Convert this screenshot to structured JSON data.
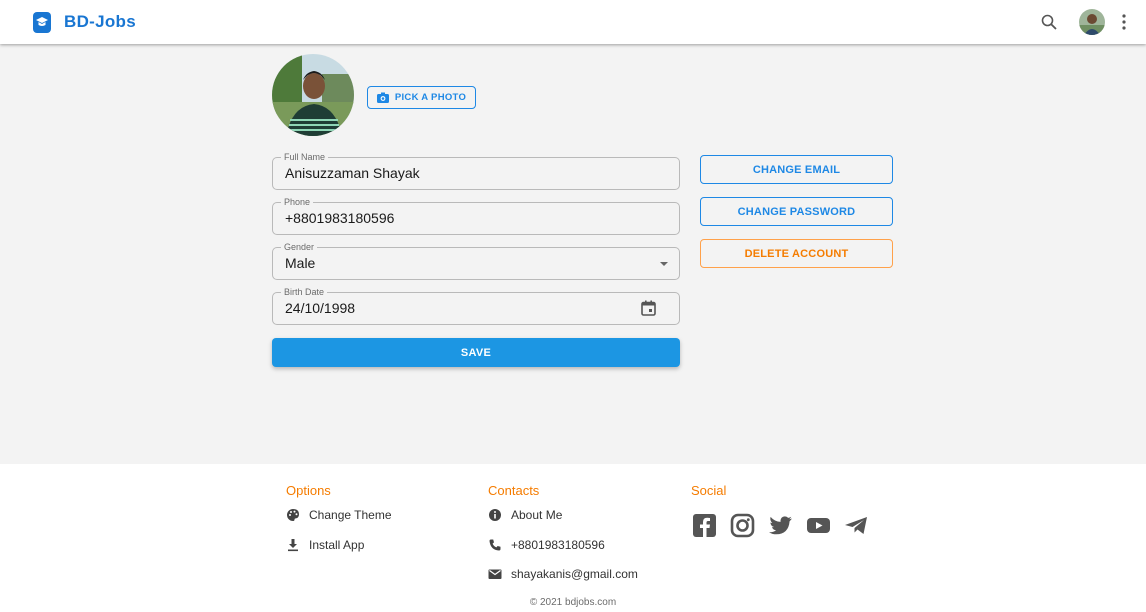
{
  "app": {
    "name": "BD-Jobs"
  },
  "profile": {
    "pick_photo_label": "PICK A PHOTO",
    "fields": {
      "full_name": {
        "label": "Full Name",
        "value": "Anisuzzaman Shayak"
      },
      "phone": {
        "label": "Phone",
        "value": "+8801983180596"
      },
      "gender": {
        "label": "Gender",
        "value": "Male"
      },
      "birth_date": {
        "label": "Birth Date",
        "value": "24/10/1998"
      }
    },
    "save_label": "SAVE"
  },
  "actions": {
    "change_email": "CHANGE EMAIL",
    "change_password": "CHANGE PASSWORD",
    "delete_account": "DELETE ACCOUNT"
  },
  "footer": {
    "options": {
      "title": "Options",
      "items": [
        "Change Theme",
        "Install App"
      ]
    },
    "contacts": {
      "title": "Contacts",
      "items": [
        "About Me",
        "+8801983180596",
        "shayakanis@gmail.com"
      ]
    },
    "social": {
      "title": "Social",
      "icons": [
        "facebook-icon",
        "instagram-icon",
        "twitter-icon",
        "youtube-icon",
        "telegram-icon"
      ]
    },
    "copyright": "© 2021 bdjobs.com"
  },
  "colors": {
    "primary": "#1e88e5",
    "accent": "#f57c00",
    "save": "#1c96e3",
    "background": "#f3f3f3"
  },
  "icons": {
    "search": "search-icon",
    "menu": "more-vertical-icon",
    "calendar": "calendar-icon",
    "dropdown": "dropdown-arrow-icon",
    "camera": "camera-icon"
  }
}
